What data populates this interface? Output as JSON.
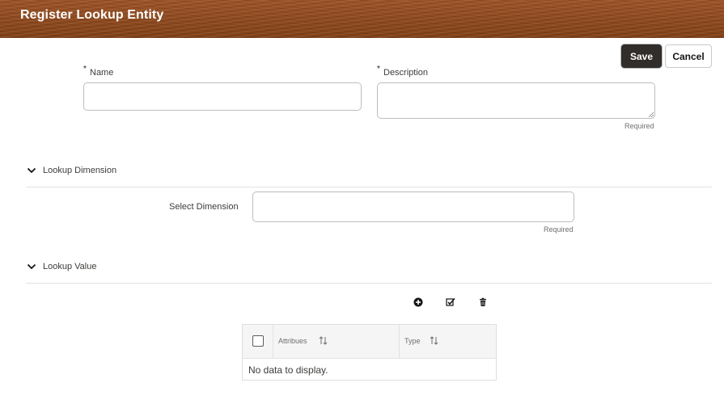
{
  "header": {
    "title": "Register Lookup Entity"
  },
  "toolbar": {
    "save_label": "Save",
    "cancel_label": "Cancel"
  },
  "form": {
    "name": {
      "label": "Name",
      "required_marker": "*",
      "value": ""
    },
    "description": {
      "label": "Description",
      "required_marker": "*",
      "value": "",
      "helper": "Required"
    }
  },
  "lookup_dimension": {
    "title": "Lookup Dimension",
    "select_label": "Select Dimension",
    "value": "",
    "helper": "Required"
  },
  "lookup_value": {
    "title": "Lookup Value",
    "toolbar_icons": [
      "add-circle-icon",
      "check-list-icon",
      "trash-icon"
    ],
    "table": {
      "columns": [
        "Attribues",
        "Type"
      ],
      "empty_text": "No data to display."
    }
  },
  "colors": {
    "header_bg": "#8a4a22",
    "primary_button": "#312d2a"
  }
}
